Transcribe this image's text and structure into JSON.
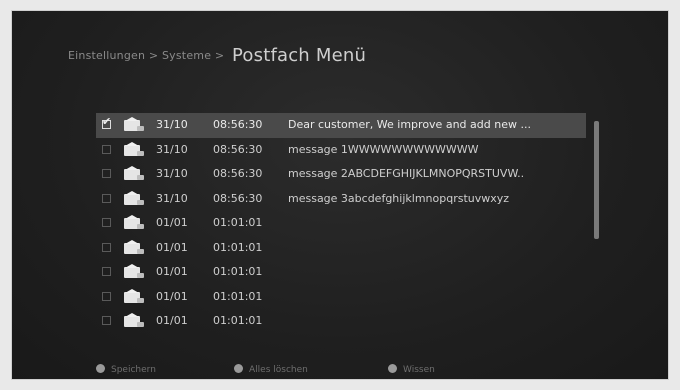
{
  "breadcrumb": {
    "path": "Einstellungen > Systeme >",
    "title": "Postfach Menü"
  },
  "messages": [
    {
      "date": "31/10",
      "time": "08:56:30",
      "text": "Dear customer, We improve and add new ...",
      "selected": true,
      "checked": true
    },
    {
      "date": "31/10",
      "time": "08:56:30",
      "text": "message 1WWWWWWWWWWWW",
      "selected": false,
      "checked": false
    },
    {
      "date": "31/10",
      "time": "08:56:30",
      "text": "message 2ABCDEFGHIJKLMNOPQRSTUVW..",
      "selected": false,
      "checked": false
    },
    {
      "date": "31/10",
      "time": "08:56:30",
      "text": "message 3abcdefghijklmnopqrstuvwxyz",
      "selected": false,
      "checked": false
    },
    {
      "date": "01/01",
      "time": "01:01:01",
      "text": "",
      "selected": false,
      "checked": false
    },
    {
      "date": "01/01",
      "time": "01:01:01",
      "text": "",
      "selected": false,
      "checked": false
    },
    {
      "date": "01/01",
      "time": "01:01:01",
      "text": "",
      "selected": false,
      "checked": false
    },
    {
      "date": "01/01",
      "time": "01:01:01",
      "text": "",
      "selected": false,
      "checked": false
    },
    {
      "date": "01/01",
      "time": "01:01:01",
      "text": "",
      "selected": false,
      "checked": false
    }
  ],
  "footer": {
    "red_label": "Speichern",
    "green_label": "Alles löschen",
    "yellow_label": "Wissen"
  },
  "icons": {
    "checkbox": "checkbox-icon",
    "envelope": "envelope-icon",
    "color_button": "color-key-icon"
  }
}
